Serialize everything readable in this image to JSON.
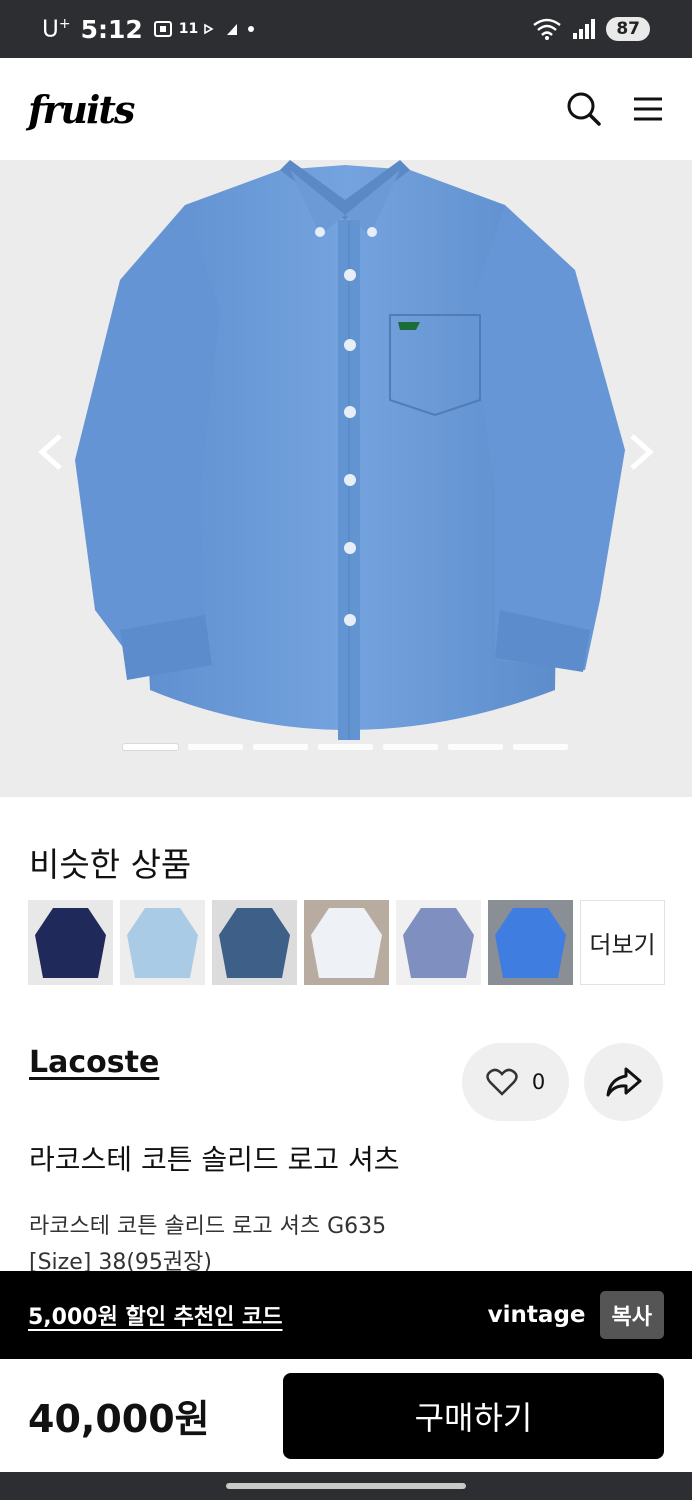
{
  "status_bar": {
    "carrier": "U",
    "carrier_sup": "+",
    "time": "5:12",
    "extra": "11",
    "battery": "87"
  },
  "header": {
    "logo_text": "fruits",
    "search_icon": "search-icon",
    "menu_icon": "hamburger-menu-icon"
  },
  "carousel": {
    "slide_count": 7,
    "active_index": 0,
    "prev_icon": "chevron-left-icon",
    "next_icon": "chevron-right-icon",
    "shirt_color": "#6a9bd8"
  },
  "similar": {
    "title": "비슷한 상품",
    "thumbnails": [
      {
        "color": "#1f2a5a",
        "bg": "#e8e8e8"
      },
      {
        "color": "#a9cbe6",
        "bg": "#ededed"
      },
      {
        "color": "#3e5f87",
        "bg": "#dcdcdc"
      },
      {
        "color": "#eef2f7",
        "bg": "#b7ac9f"
      },
      {
        "color": "#7f8fc0",
        "bg": "#f0f0f0"
      },
      {
        "color": "#3f7ee0",
        "bg": "#8a8f96"
      }
    ],
    "more_label": "더보기"
  },
  "product": {
    "brand": "Lacoste",
    "like_count": "0",
    "title": "라코스테 코튼 솔리드 로고 셔츠",
    "desc_line1": "라코스테 코튼 솔리드 로고 셔츠 G635",
    "desc_line2": "[Size]  38(95권장)"
  },
  "referral": {
    "text": "5,000원 할인 추천인 코드",
    "code": "vintage",
    "copy_label": "복사"
  },
  "purchase": {
    "price": "40,000원",
    "buy_label": "구매하기"
  }
}
